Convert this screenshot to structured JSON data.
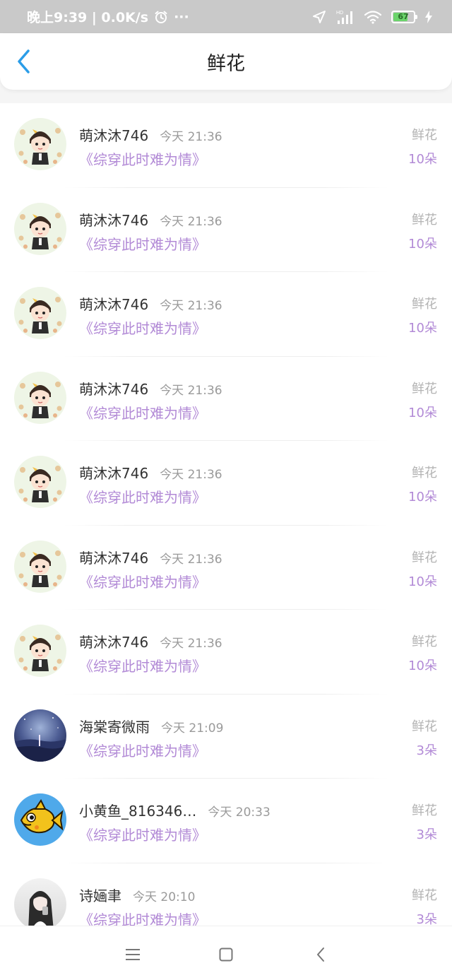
{
  "status_bar": {
    "time_text": "晚上9:39 | 0.0K/s",
    "more": "···",
    "battery": "67"
  },
  "header": {
    "title": "鲜花"
  },
  "rows": [
    {
      "name": "萌沐沐746",
      "time": "今天 21:36",
      "book": "《综穿此时难为情》",
      "gift": "鲜花",
      "count": "10朵",
      "avatar": "chibi"
    },
    {
      "name": "萌沐沐746",
      "time": "今天 21:36",
      "book": "《综穿此时难为情》",
      "gift": "鲜花",
      "count": "10朵",
      "avatar": "chibi"
    },
    {
      "name": "萌沐沐746",
      "time": "今天 21:36",
      "book": "《综穿此时难为情》",
      "gift": "鲜花",
      "count": "10朵",
      "avatar": "chibi"
    },
    {
      "name": "萌沐沐746",
      "time": "今天 21:36",
      "book": "《综穿此时难为情》",
      "gift": "鲜花",
      "count": "10朵",
      "avatar": "chibi"
    },
    {
      "name": "萌沐沐746",
      "time": "今天 21:36",
      "book": "《综穿此时难为情》",
      "gift": "鲜花",
      "count": "10朵",
      "avatar": "chibi"
    },
    {
      "name": "萌沐沐746",
      "time": "今天 21:36",
      "book": "《综穿此时难为情》",
      "gift": "鲜花",
      "count": "10朵",
      "avatar": "chibi"
    },
    {
      "name": "萌沐沐746",
      "time": "今天 21:36",
      "book": "《综穿此时难为情》",
      "gift": "鲜花",
      "count": "10朵",
      "avatar": "chibi"
    },
    {
      "name": "海棠寄微雨",
      "time": "今天 21:09",
      "book": "《综穿此时难为情》",
      "gift": "鲜花",
      "count": "3朵",
      "avatar": "night"
    },
    {
      "name": "小黄鱼_816346…",
      "time": "今天 20:33",
      "book": "《综穿此时难为情》",
      "gift": "鲜花",
      "count": "3朵",
      "avatar": "fish"
    },
    {
      "name": "诗婳聿",
      "time": "今天 20:10",
      "book": "《综穿此时难为情》",
      "gift": "鲜花",
      "count": "3朵",
      "avatar": "girl"
    }
  ],
  "colors": {
    "accent_blue": "#2b9de8",
    "book_purple": "#b28ad6",
    "status_bar_bg": "#c9c9c9"
  }
}
